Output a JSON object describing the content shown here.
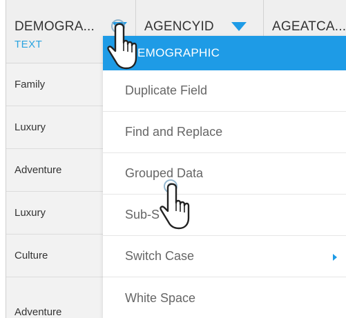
{
  "columns": [
    {
      "name": "DEMOGRA...",
      "type": "TEXT"
    },
    {
      "name": "AGENCYID",
      "type": ""
    },
    {
      "name": "AGEATCA...",
      "type": ""
    }
  ],
  "rows": [
    "Family",
    "Luxury",
    "Adventure",
    "Luxury",
    "Culture",
    "Adventure"
  ],
  "menu": {
    "header": "EMOGRAPHIC",
    "items": [
      {
        "label": "Duplicate Field",
        "has_submenu": false
      },
      {
        "label": "Find and Replace",
        "has_submenu": false
      },
      {
        "label": "Grouped Data",
        "has_submenu": false
      },
      {
        "label": "Sub-S    g",
        "has_submenu": false
      },
      {
        "label": "Switch Case",
        "has_submenu": true
      },
      {
        "label": "White Space",
        "has_submenu": false
      }
    ]
  },
  "colors": {
    "accent": "#1e9be6",
    "type_label": "#29a3e0",
    "header_bg": "#efefef",
    "cell_bg": "#f2f2f2"
  },
  "icons": [
    "dropdown-triangle-icon",
    "hand-pointer-icon",
    "submenu-arrow-icon"
  ]
}
